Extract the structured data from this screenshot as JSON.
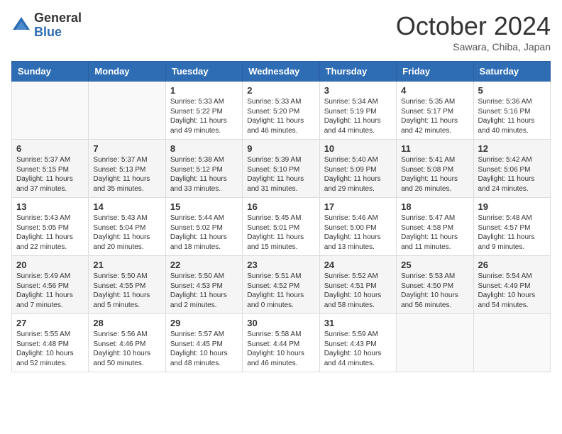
{
  "header": {
    "logo_general": "General",
    "logo_blue": "Blue",
    "month": "October 2024",
    "location": "Sawara, Chiba, Japan"
  },
  "weekdays": [
    "Sunday",
    "Monday",
    "Tuesday",
    "Wednesday",
    "Thursday",
    "Friday",
    "Saturday"
  ],
  "weeks": [
    [
      {
        "day": "",
        "sunrise": "",
        "sunset": "",
        "daylight": ""
      },
      {
        "day": "",
        "sunrise": "",
        "sunset": "",
        "daylight": ""
      },
      {
        "day": "1",
        "sunrise": "Sunrise: 5:33 AM",
        "sunset": "Sunset: 5:22 PM",
        "daylight": "Daylight: 11 hours and 49 minutes."
      },
      {
        "day": "2",
        "sunrise": "Sunrise: 5:33 AM",
        "sunset": "Sunset: 5:20 PM",
        "daylight": "Daylight: 11 hours and 46 minutes."
      },
      {
        "day": "3",
        "sunrise": "Sunrise: 5:34 AM",
        "sunset": "Sunset: 5:19 PM",
        "daylight": "Daylight: 11 hours and 44 minutes."
      },
      {
        "day": "4",
        "sunrise": "Sunrise: 5:35 AM",
        "sunset": "Sunset: 5:17 PM",
        "daylight": "Daylight: 11 hours and 42 minutes."
      },
      {
        "day": "5",
        "sunrise": "Sunrise: 5:36 AM",
        "sunset": "Sunset: 5:16 PM",
        "daylight": "Daylight: 11 hours and 40 minutes."
      }
    ],
    [
      {
        "day": "6",
        "sunrise": "Sunrise: 5:37 AM",
        "sunset": "Sunset: 5:15 PM",
        "daylight": "Daylight: 11 hours and 37 minutes."
      },
      {
        "day": "7",
        "sunrise": "Sunrise: 5:37 AM",
        "sunset": "Sunset: 5:13 PM",
        "daylight": "Daylight: 11 hours and 35 minutes."
      },
      {
        "day": "8",
        "sunrise": "Sunrise: 5:38 AM",
        "sunset": "Sunset: 5:12 PM",
        "daylight": "Daylight: 11 hours and 33 minutes."
      },
      {
        "day": "9",
        "sunrise": "Sunrise: 5:39 AM",
        "sunset": "Sunset: 5:10 PM",
        "daylight": "Daylight: 11 hours and 31 minutes."
      },
      {
        "day": "10",
        "sunrise": "Sunrise: 5:40 AM",
        "sunset": "Sunset: 5:09 PM",
        "daylight": "Daylight: 11 hours and 29 minutes."
      },
      {
        "day": "11",
        "sunrise": "Sunrise: 5:41 AM",
        "sunset": "Sunset: 5:08 PM",
        "daylight": "Daylight: 11 hours and 26 minutes."
      },
      {
        "day": "12",
        "sunrise": "Sunrise: 5:42 AM",
        "sunset": "Sunset: 5:06 PM",
        "daylight": "Daylight: 11 hours and 24 minutes."
      }
    ],
    [
      {
        "day": "13",
        "sunrise": "Sunrise: 5:43 AM",
        "sunset": "Sunset: 5:05 PM",
        "daylight": "Daylight: 11 hours and 22 minutes."
      },
      {
        "day": "14",
        "sunrise": "Sunrise: 5:43 AM",
        "sunset": "Sunset: 5:04 PM",
        "daylight": "Daylight: 11 hours and 20 minutes."
      },
      {
        "day": "15",
        "sunrise": "Sunrise: 5:44 AM",
        "sunset": "Sunset: 5:02 PM",
        "daylight": "Daylight: 11 hours and 18 minutes."
      },
      {
        "day": "16",
        "sunrise": "Sunrise: 5:45 AM",
        "sunset": "Sunset: 5:01 PM",
        "daylight": "Daylight: 11 hours and 15 minutes."
      },
      {
        "day": "17",
        "sunrise": "Sunrise: 5:46 AM",
        "sunset": "Sunset: 5:00 PM",
        "daylight": "Daylight: 11 hours and 13 minutes."
      },
      {
        "day": "18",
        "sunrise": "Sunrise: 5:47 AM",
        "sunset": "Sunset: 4:58 PM",
        "daylight": "Daylight: 11 hours and 11 minutes."
      },
      {
        "day": "19",
        "sunrise": "Sunrise: 5:48 AM",
        "sunset": "Sunset: 4:57 PM",
        "daylight": "Daylight: 11 hours and 9 minutes."
      }
    ],
    [
      {
        "day": "20",
        "sunrise": "Sunrise: 5:49 AM",
        "sunset": "Sunset: 4:56 PM",
        "daylight": "Daylight: 11 hours and 7 minutes."
      },
      {
        "day": "21",
        "sunrise": "Sunrise: 5:50 AM",
        "sunset": "Sunset: 4:55 PM",
        "daylight": "Daylight: 11 hours and 5 minutes."
      },
      {
        "day": "22",
        "sunrise": "Sunrise: 5:50 AM",
        "sunset": "Sunset: 4:53 PM",
        "daylight": "Daylight: 11 hours and 2 minutes."
      },
      {
        "day": "23",
        "sunrise": "Sunrise: 5:51 AM",
        "sunset": "Sunset: 4:52 PM",
        "daylight": "Daylight: 11 hours and 0 minutes."
      },
      {
        "day": "24",
        "sunrise": "Sunrise: 5:52 AM",
        "sunset": "Sunset: 4:51 PM",
        "daylight": "Daylight: 10 hours and 58 minutes."
      },
      {
        "day": "25",
        "sunrise": "Sunrise: 5:53 AM",
        "sunset": "Sunset: 4:50 PM",
        "daylight": "Daylight: 10 hours and 56 minutes."
      },
      {
        "day": "26",
        "sunrise": "Sunrise: 5:54 AM",
        "sunset": "Sunset: 4:49 PM",
        "daylight": "Daylight: 10 hours and 54 minutes."
      }
    ],
    [
      {
        "day": "27",
        "sunrise": "Sunrise: 5:55 AM",
        "sunset": "Sunset: 4:48 PM",
        "daylight": "Daylight: 10 hours and 52 minutes."
      },
      {
        "day": "28",
        "sunrise": "Sunrise: 5:56 AM",
        "sunset": "Sunset: 4:46 PM",
        "daylight": "Daylight: 10 hours and 50 minutes."
      },
      {
        "day": "29",
        "sunrise": "Sunrise: 5:57 AM",
        "sunset": "Sunset: 4:45 PM",
        "daylight": "Daylight: 10 hours and 48 minutes."
      },
      {
        "day": "30",
        "sunrise": "Sunrise: 5:58 AM",
        "sunset": "Sunset: 4:44 PM",
        "daylight": "Daylight: 10 hours and 46 minutes."
      },
      {
        "day": "31",
        "sunrise": "Sunrise: 5:59 AM",
        "sunset": "Sunset: 4:43 PM",
        "daylight": "Daylight: 10 hours and 44 minutes."
      },
      {
        "day": "",
        "sunrise": "",
        "sunset": "",
        "daylight": ""
      },
      {
        "day": "",
        "sunrise": "",
        "sunset": "",
        "daylight": ""
      }
    ]
  ]
}
